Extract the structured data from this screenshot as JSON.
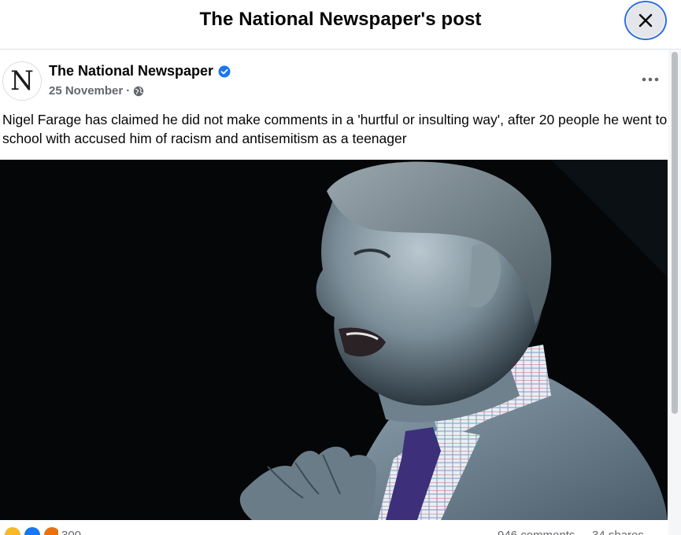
{
  "header": {
    "title": "The National Newspaper's post"
  },
  "post": {
    "page_name": "The National Newspaper",
    "avatar_letter": "N",
    "date": "25 November",
    "separator": "·",
    "text": "Nigel Farage has claimed he did not make comments in a 'hurtful or insulting way', after 20 people he went to school with accused him of racism and antisemitism as a teenager",
    "more_label": "•••"
  },
  "reactions": {
    "count": "300",
    "comments": "946 comments",
    "shares": "34 shares"
  },
  "colors": {
    "accent": "#1877f2",
    "close_ring": "#2d6fe0",
    "photo_bg": "#040608",
    "muted": "#65676b"
  },
  "icons": {
    "close": "close-icon",
    "verified": "verified-badge-icon",
    "globe": "globe-icon",
    "more": "more-options-icon"
  }
}
